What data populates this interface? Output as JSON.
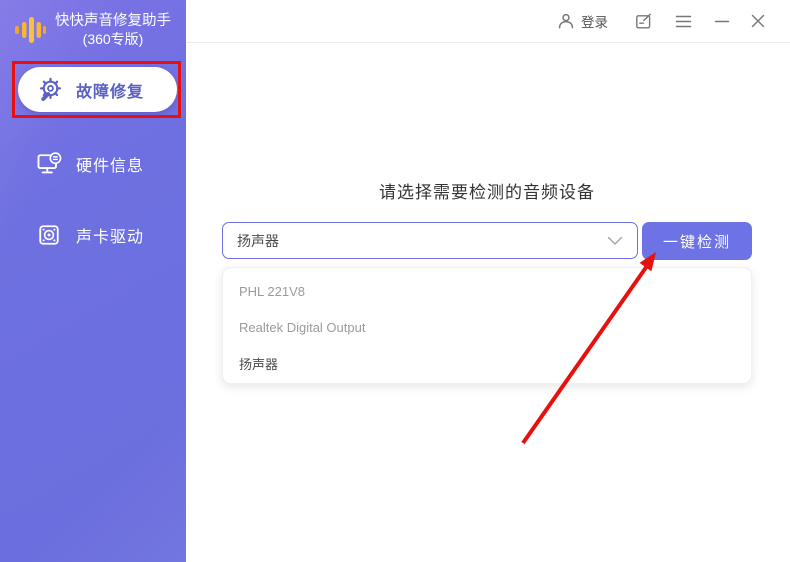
{
  "app": {
    "title_line1": "快快声音修复助手",
    "title_line2": "(360专版)",
    "logo_icon": "audio-waveform-icon"
  },
  "sidebar": {
    "items": [
      {
        "label": "故障修复",
        "icon": "gear-repair-icon",
        "active": true,
        "annotated": true
      },
      {
        "label": "硬件信息",
        "icon": "hardware-info-icon",
        "active": false
      },
      {
        "label": "声卡驱动",
        "icon": "sound-card-icon",
        "active": false
      }
    ]
  },
  "topbar": {
    "login_label": "登录",
    "icons": [
      "user-icon",
      "feedback-icon",
      "menu-icon",
      "minimize-icon",
      "close-icon"
    ]
  },
  "main": {
    "prompt": "请选择需要检测的音频设备",
    "device_select_value": "扬声器",
    "detect_button_label": "一键检测",
    "device_options": [
      "PHL 221V8",
      "Realtek Digital Output",
      "扬声器"
    ]
  },
  "annotations": {
    "highlight_box": "red rectangle around 故障修复",
    "arrow": "red arrow pointing to 一键检测 button"
  },
  "colors": {
    "sidebar_purple": "#6b6fde",
    "accent_purple": "#6d72e4",
    "active_text_purple": "#5b60c4",
    "annotation_red": "#e8100c",
    "logo_yellow": "#f7b52c"
  }
}
